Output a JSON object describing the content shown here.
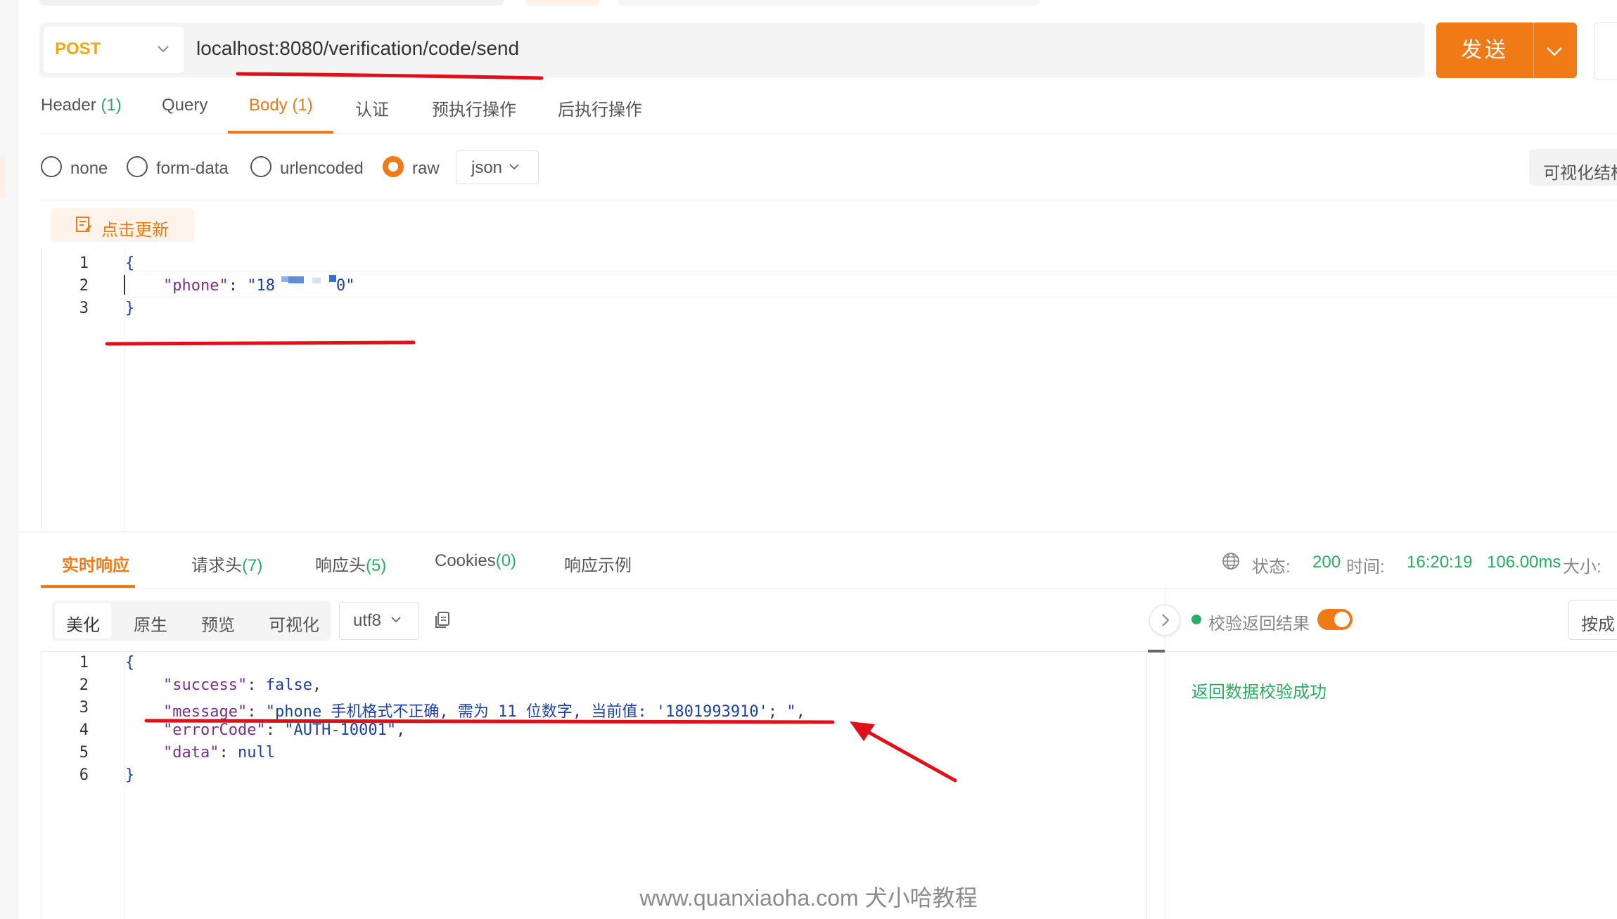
{
  "colors": {
    "accent": "#f07a16",
    "success": "#27ae60",
    "method": "#f4a31b",
    "annotation": "#e0101a"
  },
  "request": {
    "method": "POST",
    "url": "localhost:8080/verification/code/send",
    "send_label": "发送"
  },
  "request_tabs": [
    {
      "label": "Header",
      "count": "(1)"
    },
    {
      "label": "Query",
      "count": ""
    },
    {
      "label": "Body",
      "count": "(1)",
      "active": true
    },
    {
      "label": "认证",
      "count": ""
    },
    {
      "label": "预执行操作",
      "count": ""
    },
    {
      "label": "后执行操作",
      "count": ""
    }
  ],
  "body_types": {
    "options": [
      "none",
      "form-data",
      "urlencoded",
      "raw"
    ],
    "selected": "raw",
    "format": "json",
    "visualize_label": "可视化结构"
  },
  "update_button": {
    "label": "点击更新",
    "icon": "edit-note-icon"
  },
  "request_body": {
    "line_numbers": [
      "1",
      "2",
      "3"
    ],
    "open_brace": "{",
    "key": "\"phone\"",
    "colon": ": ",
    "value_start": "\"18",
    "value_end": "0\"",
    "close_brace": "}"
  },
  "response_tabs": [
    {
      "label": "实时响应",
      "count": "",
      "active": true
    },
    {
      "label": "请求头",
      "count": "(7)"
    },
    {
      "label": "响应头",
      "count": "(5)"
    },
    {
      "label": "Cookies",
      "count": "(0)"
    },
    {
      "label": "响应示例",
      "count": ""
    }
  ],
  "response_status": {
    "status_label": "状态:",
    "status_value": "200",
    "time_label": "时间:",
    "time_value": "16:20:19",
    "duration": "106.00ms",
    "size_label": "大小:"
  },
  "response_view": {
    "modes": [
      "美化",
      "原生",
      "预览",
      "可视化"
    ],
    "active_mode": "美化",
    "encoding": "utf8"
  },
  "response_body": {
    "line_numbers": [
      "1",
      "2",
      "3",
      "4",
      "5",
      "6"
    ],
    "open_brace": "{",
    "success_key": "\"success\"",
    "success_value": "false",
    "message_key": "\"message\"",
    "message_value": "\"phone 手机格式不正确, 需为 11 位数字, 当前值: '1801993910'; \"",
    "errorcode_key": "\"errorCode\"",
    "errorcode_value": "\"AUTH-10001\"",
    "data_key": "\"data\"",
    "data_value": "null",
    "close_brace": "}"
  },
  "validation": {
    "label": "校验返回结果",
    "enabled": true,
    "result": "返回数据校验成功",
    "right_button": "按成"
  },
  "watermark": "www.quanxiaoha.com 犬小哈教程"
}
